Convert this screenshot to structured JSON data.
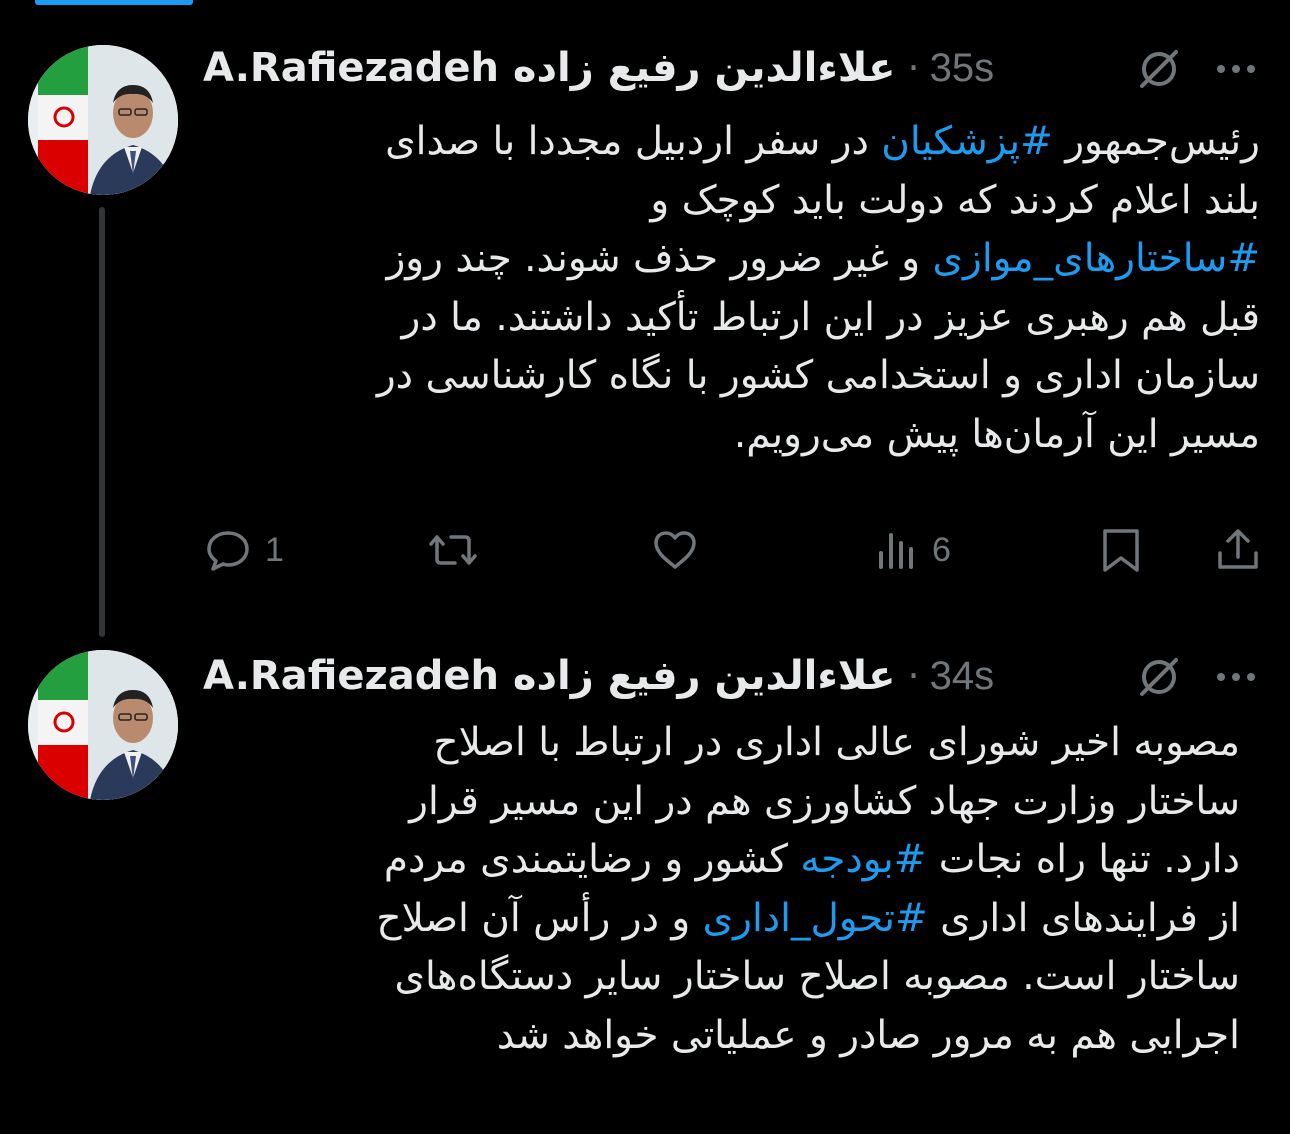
{
  "colors": {
    "background": "#000000",
    "text": "#e7e9ea",
    "secondary": "#71767b",
    "accent": "#1d9bf0",
    "thread_line": "#333639"
  },
  "tweets": [
    {
      "display_name": "A.Rafiezadeh علاءالدین رفیع زاده",
      "separator": "·",
      "time": "35s",
      "lines": [
        [
          {
            "t": "رئیس‌جمهور "
          },
          {
            "t": "#پزشکیان",
            "tag": true
          },
          {
            "t": " در سفر اردبیل مجددا با صدای"
          }
        ],
        [
          {
            "t": "بلند اعلام کردند که دولت باید کوچک و"
          }
        ],
        [
          {
            "t": "#ساختارهای_موازی",
            "tag": true
          },
          {
            "t": " و غیر ضرور حذف شوند. چند روز"
          }
        ],
        [
          {
            "t": "قبل هم رهبری عزیز در این ارتباط تأکید داشتند. ما در"
          }
        ],
        [
          {
            "t": "سازمان اداری و استخدامی کشور با نگاه کارشناسی در"
          }
        ],
        [
          {
            "t": "مسیر این آرمان‌ها پیش می‌رویم."
          }
        ]
      ],
      "actions": {
        "reply_icon": "reply-icon",
        "reply_count": "1",
        "repost_icon": "repost-icon",
        "like_icon": "heart-icon",
        "views_icon": "views-icon",
        "views_count": "6",
        "bookmark_icon": "bookmark-icon",
        "share_icon": "share-icon"
      },
      "grok_icon": "grok-icon",
      "more_icon": "more-icon"
    },
    {
      "display_name": "A.Rafiezadeh علاءالدین رفیع زاده",
      "separator": "·",
      "time": "34s",
      "lines": [
        [
          {
            "t": "مصوبه اخیر شورای عالی اداری در ارتباط با اصلاح"
          }
        ],
        [
          {
            "t": "ساختار وزارت جهاد کشاورزی هم در این مسیر قرار"
          }
        ],
        [
          {
            "t": "دارد. تنها راه نجات "
          },
          {
            "t": "#بودجه",
            "tag": true
          },
          {
            "t": " کشور و رضایتمندی مردم"
          }
        ],
        [
          {
            "t": "از فرایندهای اداری "
          },
          {
            "t": "#تحول_اداری",
            "tag": true
          },
          {
            "t": " و در رأس آن اصلاح"
          }
        ],
        [
          {
            "t": "ساختار  است. مصوبه اصلاح ساختار سایر دستگاه‌های"
          }
        ],
        [
          {
            "t": "اجرایی هم به مرور صادر و عملیاتی خواهد شد"
          }
        ]
      ],
      "grok_icon": "grok-icon",
      "more_icon": "more-icon"
    }
  ]
}
